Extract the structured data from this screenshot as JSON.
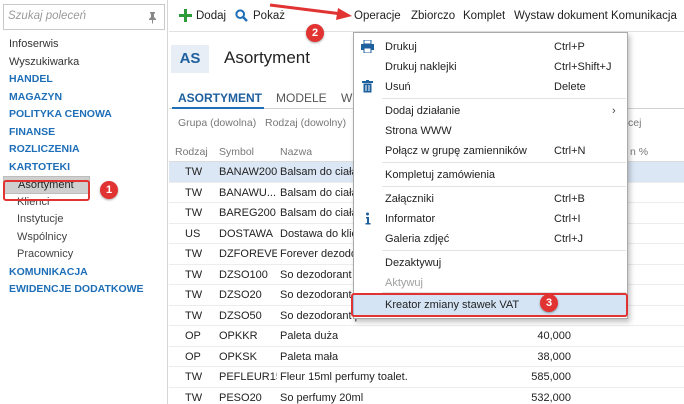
{
  "sidebar": {
    "search_placeholder": "Szukaj poleceń",
    "items": [
      {
        "label": "Infoserwis",
        "kind": "plain"
      },
      {
        "label": "Wyszukiwarka",
        "kind": "plain"
      },
      {
        "label": "HANDEL",
        "kind": "section"
      },
      {
        "label": "MAGAZYN",
        "kind": "section"
      },
      {
        "label": "POLITYKA CENOWA",
        "kind": "section"
      },
      {
        "label": "FINANSE",
        "kind": "section"
      },
      {
        "label": "ROZLICZENIA",
        "kind": "section"
      },
      {
        "label": "KARTOTEKI",
        "kind": "section"
      },
      {
        "label": "Asortyment",
        "kind": "selected"
      },
      {
        "label": "Klienci",
        "kind": "sub"
      },
      {
        "label": "Instytucje",
        "kind": "sub"
      },
      {
        "label": "Wspólnicy",
        "kind": "sub"
      },
      {
        "label": "Pracownicy",
        "kind": "sub"
      },
      {
        "label": "KOMUNIKACJA",
        "kind": "section"
      },
      {
        "label": "EWIDENCJE DODATKOWE",
        "kind": "section"
      }
    ]
  },
  "toolbar": {
    "add_label": "Dodaj",
    "show_label": "Pokaż",
    "operations_label": "Operacje",
    "collection_label": "Zbiorczo",
    "set_label": "Komplet",
    "issue_doc_label": "Wystaw dokument",
    "communication_label": "Komunikacja"
  },
  "module": {
    "badge": "AS",
    "title": "Asortyment",
    "tabs": [
      "ASORTYMENT",
      "MODELE",
      "Wi"
    ],
    "filters": [
      "Grupa (dowolna)",
      "Rodzaj (dowolny)",
      "cej"
    ],
    "columns": {
      "rodzaj": "Rodzaj",
      "symbol": "Symbol",
      "nazwa": "Nazwa",
      "percent": "n %"
    }
  },
  "table": {
    "rows": [
      {
        "rodzaj": "TW",
        "symbol": "BANAW200",
        "nazwa": "Balsam do ciała",
        "value": ""
      },
      {
        "rodzaj": "TW",
        "symbol": "BANAWU...",
        "nazwa": "Balsam do ciała",
        "value": ""
      },
      {
        "rodzaj": "TW",
        "symbol": "BAREG200",
        "nazwa": "Balsam do ciała",
        "value": ""
      },
      {
        "rodzaj": "US",
        "symbol": "DOSTAWA",
        "nazwa": "Dostawa do klie",
        "value": ""
      },
      {
        "rodzaj": "TW",
        "symbol": "DZFOREVER",
        "nazwa": "Forever dezodo",
        "value": ""
      },
      {
        "rodzaj": "TW",
        "symbol": "DZSO100",
        "nazwa": "So dezodorant p",
        "value": ""
      },
      {
        "rodzaj": "TW",
        "symbol": "DZSO20",
        "nazwa": "So dezodorant p",
        "value": ""
      },
      {
        "rodzaj": "TW",
        "symbol": "DZSO50",
        "nazwa": "So dezodorant p",
        "value": ""
      },
      {
        "rodzaj": "OP",
        "symbol": "OPKKR",
        "nazwa": "Paleta duża",
        "value": "40,000"
      },
      {
        "rodzaj": "OP",
        "symbol": "OPKSK",
        "nazwa": "Paleta mała",
        "value": "38,000"
      },
      {
        "rodzaj": "TW",
        "symbol": "PEFLEUR15",
        "nazwa": "Fleur 15ml perfumy toalet.",
        "value": "585,000"
      },
      {
        "rodzaj": "TW",
        "symbol": "PESO20",
        "nazwa": "So perfumy 20ml",
        "value": "532,000"
      }
    ]
  },
  "menu": {
    "items": [
      {
        "label": "Drukuj",
        "shortcut": "Ctrl+P",
        "icon": "printer-icon"
      },
      {
        "label": "Drukuj naklejki",
        "shortcut": "Ctrl+Shift+J",
        "icon": ""
      },
      {
        "label": "Usuń",
        "shortcut": "Delete",
        "icon": "trash-icon"
      },
      {
        "label": "Dodaj działanie",
        "shortcut": "",
        "icon": "",
        "submenu": true
      },
      {
        "label": "Strona WWW",
        "shortcut": "",
        "icon": ""
      },
      {
        "label": "Połącz w grupę zamienników",
        "shortcut": "Ctrl+N",
        "icon": ""
      },
      {
        "label": "Kompletuj zamówienia",
        "shortcut": "",
        "icon": ""
      },
      {
        "label": "Załączniki",
        "shortcut": "Ctrl+B",
        "icon": ""
      },
      {
        "label": "Informator",
        "shortcut": "Ctrl+I",
        "icon": "info-icon"
      },
      {
        "label": "Galeria zdjęć",
        "shortcut": "Ctrl+J",
        "icon": ""
      },
      {
        "label": "Dezaktywuj",
        "shortcut": "",
        "icon": ""
      },
      {
        "label": "Aktywuj",
        "shortcut": "",
        "icon": "",
        "disabled": true
      },
      {
        "label": "Kreator zmiany stawek VAT",
        "shortcut": "",
        "icon": "",
        "hover": true
      }
    ]
  },
  "markers": [
    "1",
    "2",
    "3"
  ],
  "colors": {
    "accent": "#1e6fb8",
    "marker": "#e13331",
    "add_green": "#2e9b3a"
  }
}
